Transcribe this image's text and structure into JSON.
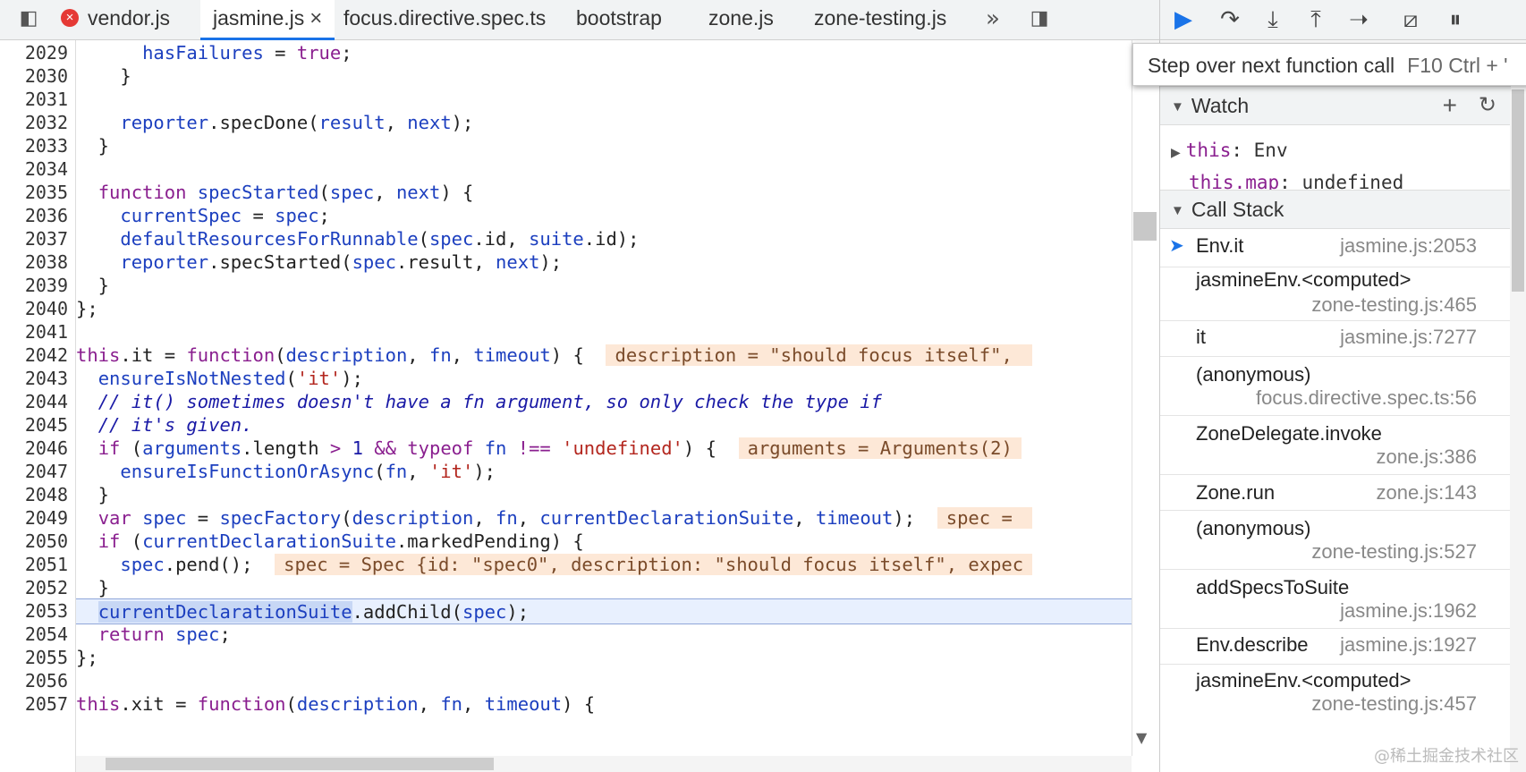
{
  "tabs": [
    {
      "label": "vendor.js",
      "error": true,
      "active": false
    },
    {
      "label": "jasmine.js",
      "error": false,
      "active": true,
      "closable": true
    },
    {
      "label": "focus.directive.spec.ts",
      "error": false,
      "active": false
    },
    {
      "label": "bootstrap",
      "error": false,
      "active": false
    },
    {
      "label": "zone.js",
      "error": false,
      "active": false
    },
    {
      "label": "zone-testing.js",
      "error": false,
      "active": false
    }
  ],
  "tabbar_icons": {
    "toggle_navigator": "◧",
    "more_tabs": "»",
    "toggle_debugger": "◨",
    "close": "×"
  },
  "code": {
    "line_numbers": [
      "2029",
      "2030",
      "2031",
      "2032",
      "2033",
      "2034",
      "2035",
      "2036",
      "2037",
      "2038",
      "2039",
      "2040",
      "2041",
      "2042",
      "2043",
      "2044",
      "2045",
      "2046",
      "2047",
      "2048",
      "2049",
      "2050",
      "2051",
      "2052",
      "2053",
      "2054",
      "2055",
      "2056",
      "2057"
    ],
    "execution_line": "2053",
    "inline_values": {
      "l2042": "description = \"should focus itself\", ",
      "l2046": "arguments = Arguments(2)",
      "l2049": "spec = ",
      "l2051": "spec = Spec {id: \"spec0\", description: \"should focus itself\", expec"
    }
  },
  "debugger": {
    "toolbar_buttons": [
      "resume",
      "step-over",
      "step-into",
      "step-out",
      "step",
      "deactivate-breakpoints",
      "pause-on-exceptions"
    ],
    "tooltip": {
      "text": "Step over next function call",
      "shortcut": "F10  Ctrl + '"
    },
    "watch": {
      "title": "Watch",
      "items": [
        {
          "key": "this",
          "value": "Env",
          "expandable": true
        },
        {
          "key": "this.map",
          "value": "undefined",
          "expandable": false
        }
      ]
    },
    "call_stack": {
      "title": "Call Stack",
      "frames": [
        {
          "name": "Env.it",
          "location": "jasmine.js:2053",
          "current": true
        },
        {
          "name": "jasmineEnv.<computed>",
          "location": "zone-testing.js:465"
        },
        {
          "name": "it",
          "location": "jasmine.js:7277"
        },
        {
          "name": "(anonymous)",
          "location": "focus.directive.spec.ts:56"
        },
        {
          "name": "ZoneDelegate.invoke",
          "location": "zone.js:386"
        },
        {
          "name": "Zone.run",
          "location": "zone.js:143"
        },
        {
          "name": "(anonymous)",
          "location": "zone-testing.js:527"
        },
        {
          "name": "addSpecsToSuite",
          "location": "jasmine.js:1962"
        },
        {
          "name": "Env.describe",
          "location": "jasmine.js:1927"
        },
        {
          "name": "jasmineEnv.<computed>",
          "location": "zone-testing.js:457"
        }
      ]
    }
  },
  "watermark": "@稀土掘金技术社区",
  "colors": {
    "accent": "#1a73e8",
    "exec_line": "#e8f0fe",
    "inline_value_bg": "#fde8d7",
    "keyword": "#8a1f8f",
    "comment": "#1a1aa6",
    "string": "#b3261e"
  }
}
